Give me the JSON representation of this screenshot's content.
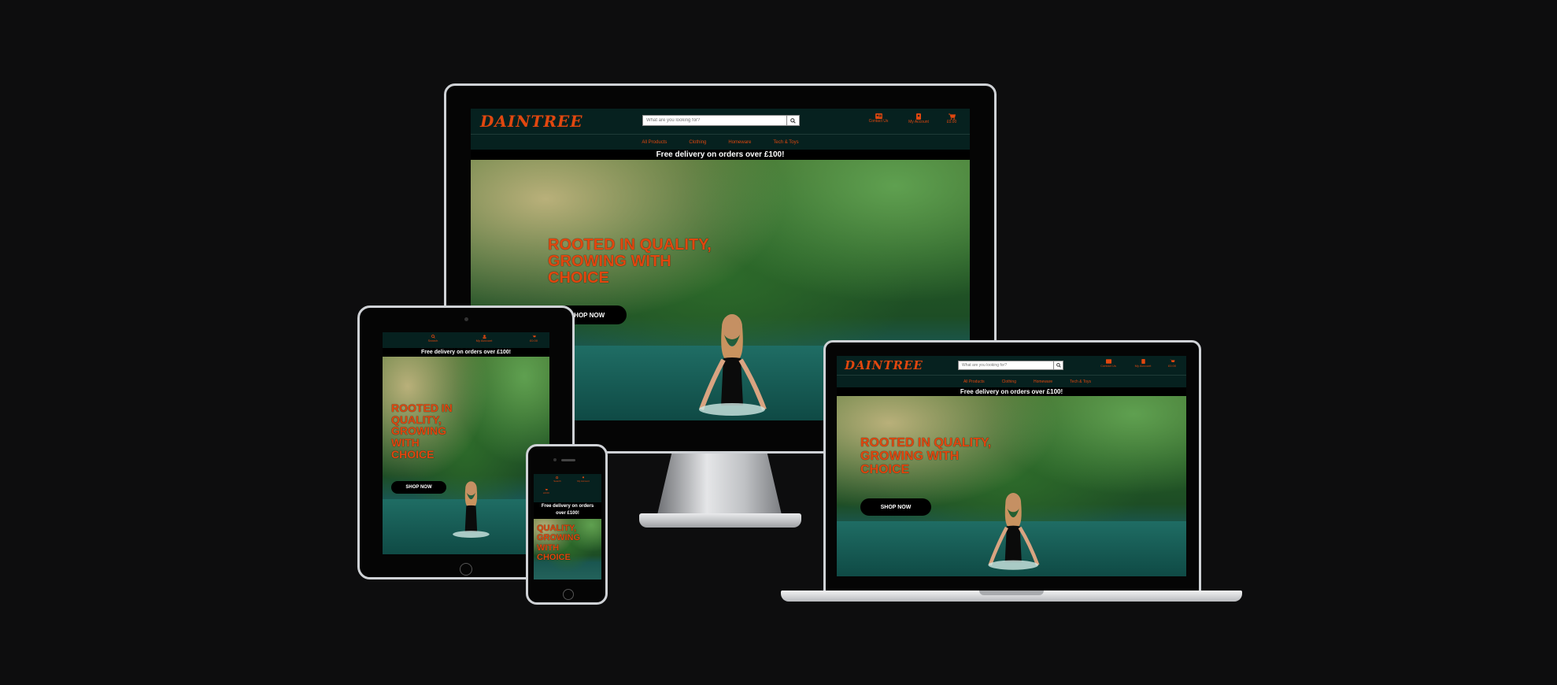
{
  "site": {
    "logo": "DAINTREE",
    "search_placeholder": "What are you looking for?",
    "contact_label": "Contact Us",
    "account_label": "My Account",
    "basket_label": "£0.00",
    "search_label": "Search",
    "nav": [
      "All Products",
      "Clothing",
      "Homeware",
      "Tech & Toys"
    ],
    "promo": "Free delivery on orders over £100!",
    "hero_line1": "ROOTED IN QUALITY,",
    "hero_line2": "GROWING WITH",
    "hero_line3": "CHOICE",
    "tablet_hero": [
      "ROOTED IN",
      "QUALITY,",
      "GROWING",
      "WITH",
      "CHOICE"
    ],
    "phone_hero": [
      "QUALITY,",
      "GROWING",
      "WITH",
      "CHOICE"
    ],
    "shop_button": "SHOP NOW",
    "phone_promo_line1": "Free delivery on orders",
    "phone_promo_line2": "over £100!"
  },
  "colors": {
    "accent": "#e1470f",
    "header_bg": "#06211f",
    "background": "#0d0d0e"
  }
}
